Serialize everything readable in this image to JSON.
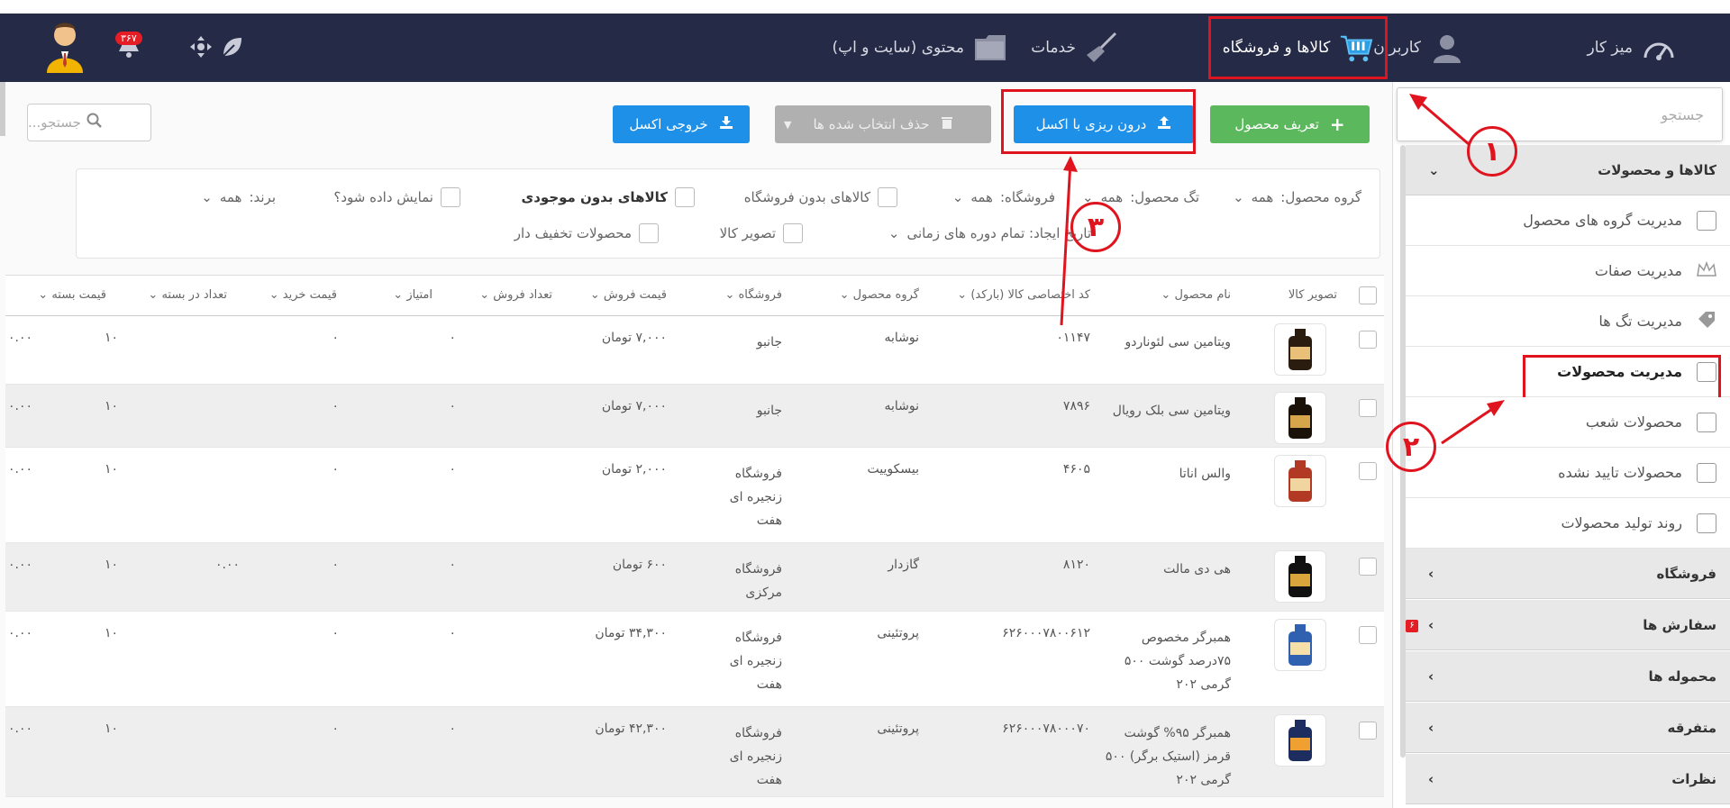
{
  "topnav": {
    "items": [
      {
        "label": "میز کار"
      },
      {
        "label": "کاربران"
      },
      {
        "label": "کالاها و فروشگاه"
      },
      {
        "label": "خدمات"
      },
      {
        "label": "محتوی (سایت و اپ)"
      }
    ],
    "notification_count": "۳۶۷"
  },
  "sidebar": {
    "search_placeholder": "جستجو",
    "groups": [
      {
        "label": "کالاها و محصولات"
      },
      {
        "label": "فروشگاه"
      },
      {
        "label": "سفارش ها",
        "badge": "۶"
      },
      {
        "label": "محموله ها"
      },
      {
        "label": "متفرقه"
      },
      {
        "label": "نظرات"
      }
    ],
    "subitems": [
      {
        "label": "مدیریت گروه های محصول"
      },
      {
        "label": "مدیریت صفات"
      },
      {
        "label": "مدیریت تگ ها"
      },
      {
        "label": "مدیریت محصولات"
      },
      {
        "label": "محصولات شعب"
      },
      {
        "label": "محصولات تایید نشده"
      },
      {
        "label": "روند تولید محصولات"
      }
    ]
  },
  "toolbar": {
    "define_product": "تعریف محصول",
    "import_excel": "درون ریزی با اکسل",
    "delete_selected": "حذف انتخاب شده ها",
    "export_excel": "خروجی اکسل",
    "search_placeholder": "جستجو..."
  },
  "filters": {
    "product_group_label": "گروه محصول:",
    "product_group_value": "همه",
    "tag_label": "تگ محصول:",
    "tag_value": "همه",
    "store_label": "فروشگاه:",
    "store_value": "همه",
    "no_store_label": "کالاهای بدون فروشگاه",
    "no_stock_label": "کالاهای بدون موجودی",
    "show_label": "نمایش داده شود؟",
    "brand_label": "برند:",
    "brand_value": "همه",
    "created_date_label": "تاریخ ایجاد: تمام دوره های زمانی",
    "product_image_label": "تصویر کالا",
    "discounted_label": "محصولات تخفیف دار"
  },
  "table": {
    "columns": [
      "تصویر کالا",
      "نام محصول",
      "کد اختصاصی کالا (بارکد)",
      "گروه محصول",
      "فروشگاه",
      "قیمت فروش",
      "تعداد فروش",
      "امتیاز",
      "قیمت خرید",
      "تعداد در بسته",
      "قیمت بسته"
    ],
    "rows": [
      {
        "name": "ویتامین سی لئوناردو",
        "code": "۰۱۱۴۷",
        "group": "نوشابه",
        "store": "جانبو",
        "price": "۷,۰۰۰ تومان",
        "sales": "۰",
        "score": "۰",
        "buy": "",
        "pack_count": "۱۰",
        "pack_price": "۰.۰۰"
      },
      {
        "name": "ویتامین سی بلک رویال",
        "code": "۷۸۹۶",
        "group": "نوشابه",
        "store": "جانبو",
        "price": "۷,۰۰۰ تومان",
        "sales": "۰",
        "score": "۰",
        "buy": "",
        "pack_count": "۱۰",
        "pack_price": "۰.۰۰"
      },
      {
        "name": "والس اناتا",
        "code": "۴۶۰۵",
        "group": "بیسکوییت",
        "store": "فروشگاه زنجیره ای هفت",
        "price": "۲,۰۰۰ تومان",
        "sales": "۰",
        "score": "۰",
        "buy": "",
        "pack_count": "۱۰",
        "pack_price": "۰.۰۰"
      },
      {
        "name": "هی دی مالت",
        "code": "۸۱۲۰",
        "group": "گازدار",
        "store": "فروشگاه مرکزی",
        "price": "۶۰۰ تومان",
        "sales": "۰",
        "score": "۰",
        "buy": "۰.۰۰",
        "pack_count": "۱۰",
        "pack_price": "۰.۰۰"
      },
      {
        "name": "همبرگر مخصوص ۷۵درصد گوشت ۵۰۰ گرمی ۲۰۲",
        "code": "۶۲۶۰۰۰۷۸۰۰۶۱۲",
        "group": "پروتئینی",
        "store": "فروشگاه زنجیره ای هفت",
        "price": "۳۴,۳۰۰ تومان",
        "sales": "۰",
        "score": "۰",
        "buy": "",
        "pack_count": "۱۰",
        "pack_price": "۰.۰۰"
      },
      {
        "name": "همبرگر ۹۵% گوشت قرمز (استیک برگر) ۵۰۰ گرمی ۲۰۲",
        "code": "۶۲۶۰۰۰۷۸۰۰۰۷۰",
        "group": "پروتئینی",
        "store": "فروشگاه زنجیره ای هفت",
        "price": "۴۲,۳۰۰ تومان",
        "sales": "۰",
        "score": "۰",
        "buy": "",
        "pack_count": "۱۰",
        "pack_price": "۰.۰۰"
      }
    ]
  },
  "annotations": [
    "۱",
    "۲",
    "۳"
  ],
  "colors": {
    "nav_bg": "#252a47",
    "highlight": "#e0141e",
    "green": "#5cb85c",
    "blue": "#1e90e8"
  }
}
